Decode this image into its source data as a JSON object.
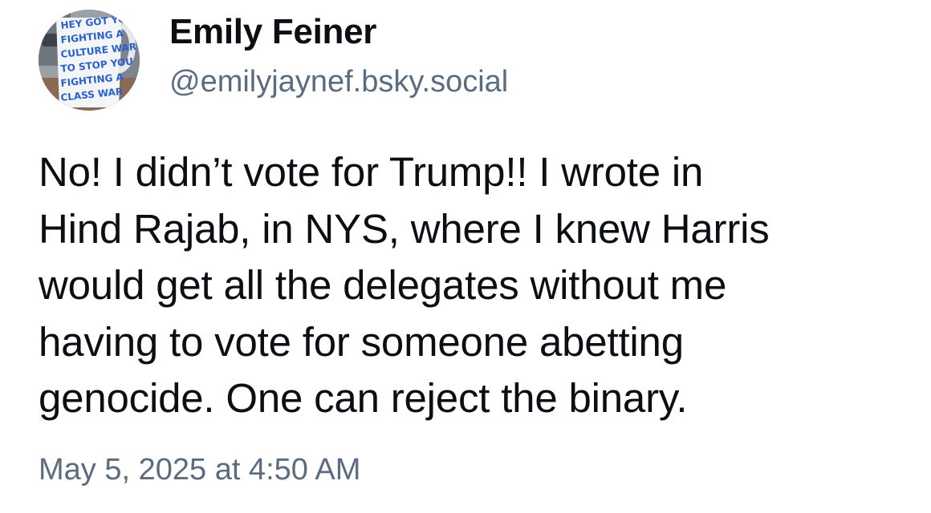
{
  "post": {
    "author": {
      "display_name": "Emily Feiner",
      "handle": "@emilyjaynef.bsky.social",
      "avatar": {
        "icon": "avatar-mug-photo",
        "lines": [
          "HEY GOT YOU",
          "FIGHTING A",
          "CULTURE WAR",
          "TO STOP YOU",
          "FIGHTING A",
          "CLASS WAR"
        ]
      }
    },
    "text": "No! I didn’t vote for Trump!! I wrote in\nHind Rajab, in NYS, where I knew Harris\nwould get all the delegates without me\nhaving to vote for someone abetting\ngenocide. One can reject the binary.",
    "timestamp": "May 5, 2025 at 4:50 AM"
  },
  "colors": {
    "text": "#0b0f14",
    "muted": "#5b6b80",
    "avatar_ink": "#2a5fd0",
    "background": "#ffffff"
  }
}
